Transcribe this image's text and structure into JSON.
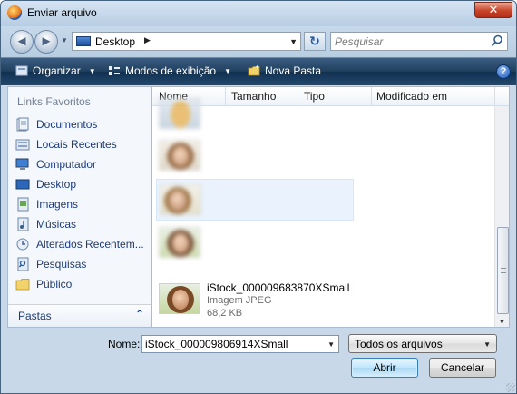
{
  "window": {
    "title": "Enviar arquivo",
    "close_glyph": "✕"
  },
  "nav": {
    "back_glyph": "◄",
    "forward_glyph": "►",
    "address": "Desktop",
    "address_sep_glyph": "▶",
    "refresh_glyph": "↻",
    "search_placeholder": "Pesquisar"
  },
  "toolbar": {
    "organize_label": "Organizar",
    "views_label": "Modos de exibição",
    "new_folder_label": "Nova Pasta",
    "help_glyph": "?"
  },
  "sidebar": {
    "heading": "Links Favoritos",
    "items": [
      {
        "label": "Documentos",
        "icon": "documents-icon"
      },
      {
        "label": "Locais Recentes",
        "icon": "recent-places-icon"
      },
      {
        "label": "Computador",
        "icon": "computer-icon"
      },
      {
        "label": "Desktop",
        "icon": "desktop-icon"
      },
      {
        "label": "Imagens",
        "icon": "pictures-icon"
      },
      {
        "label": "Músicas",
        "icon": "music-icon"
      },
      {
        "label": "Alterados Recentem...",
        "icon": "recently-changed-icon"
      },
      {
        "label": "Pesquisas",
        "icon": "searches-icon"
      },
      {
        "label": "Público",
        "icon": "public-folder-icon"
      }
    ],
    "folders_label": "Pastas",
    "folders_chevron": "⌃"
  },
  "columns": {
    "name": "Nome",
    "size": "Tamanho",
    "type": "Tipo",
    "modified": "Modificado em"
  },
  "files": [
    {
      "name": "",
      "type": "",
      "size": ""
    },
    {
      "name": "",
      "type": "",
      "size": ""
    },
    {
      "name": "",
      "type": "",
      "size": ""
    },
    {
      "name": "",
      "type": "",
      "size": ""
    },
    {
      "name": "iStock_000009683870XSmall",
      "type": "Imagem JPEG",
      "size": "68,2 KB"
    }
  ],
  "footer": {
    "name_label": "Nome:",
    "filename": "iStock_000009806914XSmall",
    "file_type": "Todos os arquivos",
    "open_label": "Abrir",
    "cancel_label": "Cancelar"
  },
  "colors": {
    "accent": "#1d3c7a",
    "toolbar": "#21405f",
    "selection": "#eaf3fd"
  }
}
